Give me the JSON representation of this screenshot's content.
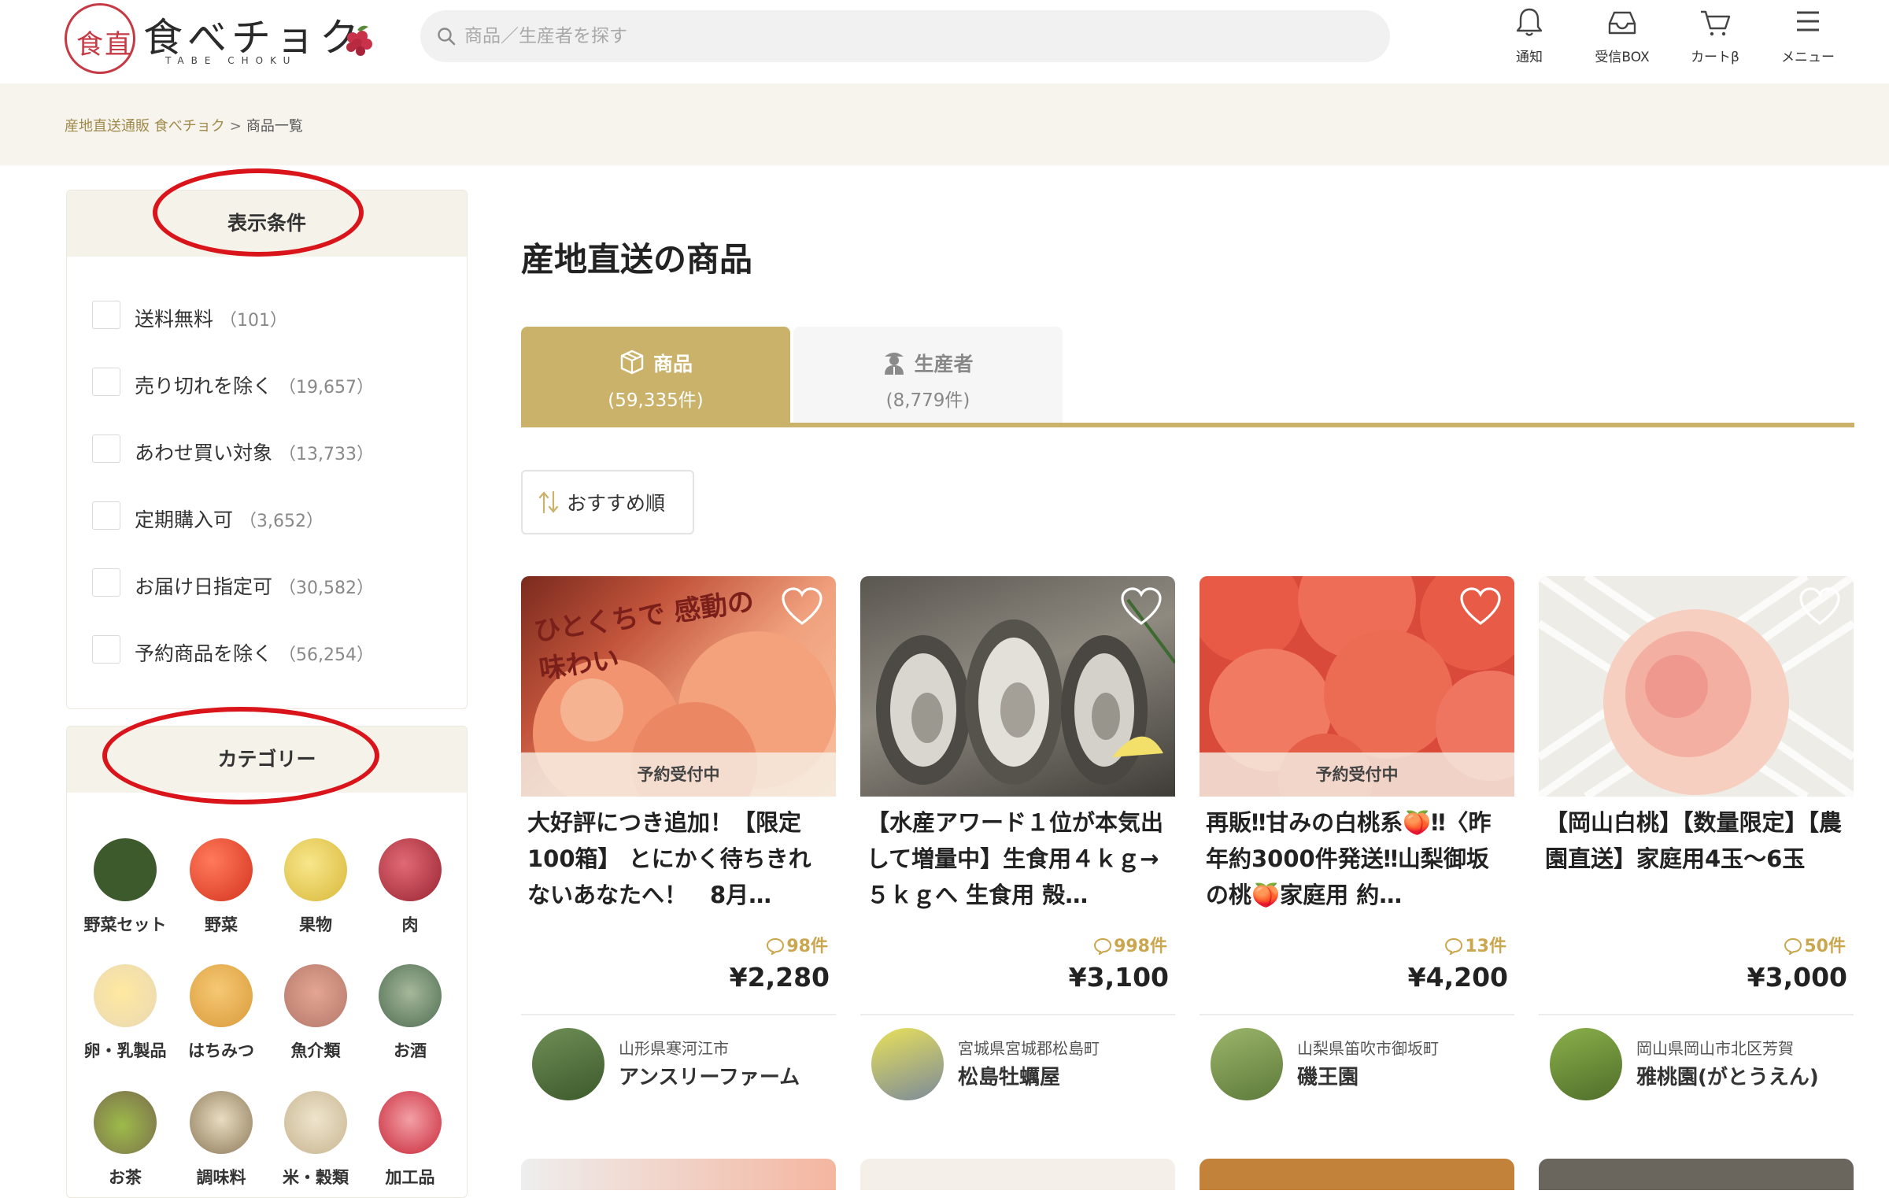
{
  "header": {
    "logo_text": "食べチョク",
    "logo_sub": "TABE CHOKU",
    "logo_seal": "食直",
    "search_placeholder": "商品／生産者を探す",
    "nav": [
      {
        "label": "通知",
        "icon": "bell-icon"
      },
      {
        "label": "受信BOX",
        "icon": "inbox-icon"
      },
      {
        "label": "カートβ",
        "icon": "cart-icon"
      },
      {
        "label": "メニュー",
        "icon": "menu-icon"
      }
    ]
  },
  "breadcrumb": {
    "home": "産地直送通販 食べチョク",
    "separator": ">",
    "current": "商品一覧"
  },
  "filters": {
    "title": "表示条件",
    "items": [
      {
        "label": "送料無料",
        "count": "（101）"
      },
      {
        "label": "売り切れを除く",
        "count": "（19,657）"
      },
      {
        "label": "あわせ買い対象",
        "count": "（13,733）"
      },
      {
        "label": "定期購入可",
        "count": "（3,652）"
      },
      {
        "label": "お届け日指定可",
        "count": "（30,582）"
      },
      {
        "label": "予約商品を除く",
        "count": "（56,254）"
      }
    ]
  },
  "categories": {
    "title": "カテゴリー",
    "items": [
      {
        "label": "野菜セット",
        "color": "#3d5a2c"
      },
      {
        "label": "野菜",
        "color": "#e2432a"
      },
      {
        "label": "果物",
        "color": "#f1d24f"
      },
      {
        "label": "肉",
        "color": "#b8323f"
      },
      {
        "label": "卵・乳製品",
        "color": "#f1e3c2"
      },
      {
        "label": "はちみつ",
        "color": "#e7a94a"
      },
      {
        "label": "魚介類",
        "color": "#c88d7a"
      },
      {
        "label": "お酒",
        "color": "#6b8a6a"
      },
      {
        "label": "お茶",
        "color": "#7a9a3a"
      },
      {
        "label": "調味料",
        "color": "#c9b48a"
      },
      {
        "label": "米・穀類",
        "color": "#d8c9a8"
      },
      {
        "label": "加工品",
        "color": "#d63a44"
      }
    ]
  },
  "main": {
    "title": "産地直送の商品",
    "tabs": [
      {
        "label": "商品",
        "count": "(59,335件)",
        "icon": "box-icon"
      },
      {
        "label": "生産者",
        "count": "(8,779件)",
        "icon": "producer-icon"
      }
    ],
    "sort_label": "おすすめ順"
  },
  "products": [
    {
      "name": "大好評につき追加！【限定100箱】 とにかく待ちきれないあなたへ！　8月…",
      "badge": "予約受付中",
      "image_text": "ひとくちで 感動の味わい",
      "reviews": "98件",
      "price": "¥2,280",
      "location": "山形県寒河江市",
      "producer": "アンスリーファーム",
      "img_color": "#e98b75"
    },
    {
      "name": "【水産アワード１位が本気出して増量中】生食用４ｋｇ→５ｋｇへ 生食用 殻…",
      "badge": "",
      "image_text": "",
      "reviews": "998件",
      "price": "¥3,100",
      "location": "宮城県宮城郡松島町",
      "producer": "松島牡蠣屋",
      "img_color": "#7f7a70"
    },
    {
      "name": "再販‼甘みの白桃系🍑‼〈昨年約3000件発送‼山梨御坂の桃🍑家庭用 約…",
      "badge": "予約受付中",
      "image_text": "",
      "reviews": "13件",
      "price": "¥4,200",
      "location": "山梨県笛吹市御坂町",
      "producer": "磯王園",
      "img_color": "#ec6a55"
    },
    {
      "name": "【岡山白桃】【数量限定】【農園直送】家庭用4玉～6玉",
      "badge": "",
      "image_text": "",
      "reviews": "50件",
      "price": "¥3,000",
      "location": "岡山県岡山市北区芳賀",
      "producer": "雅桃園(がとうえん)",
      "img_color": "#f4d0c2"
    }
  ],
  "colors": {
    "accent": "#cbb26a",
    "brand_red": "#c53a45",
    "annotation_red": "#d9151b",
    "review_gold": "#caa74f"
  }
}
